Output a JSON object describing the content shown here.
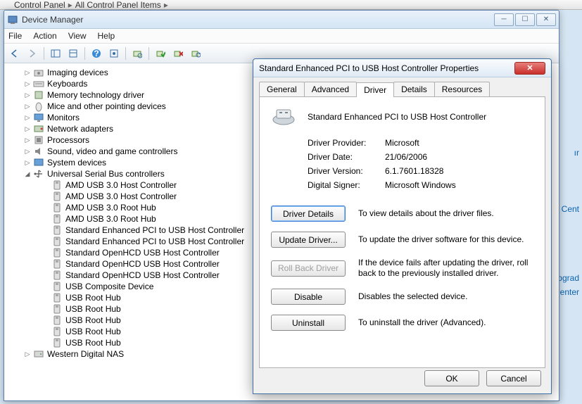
{
  "breadcrumb": {
    "a": "Control Panel",
    "b": "All Control Panel Items"
  },
  "window": {
    "title": "Device Manager",
    "menus": [
      "File",
      "Action",
      "View",
      "Help"
    ]
  },
  "tree": {
    "categories": [
      {
        "label": "Imaging devices",
        "icon": "camera",
        "expand": "▷"
      },
      {
        "label": "Keyboards",
        "icon": "keyboard",
        "expand": "▷"
      },
      {
        "label": "Memory technology driver",
        "icon": "chip",
        "expand": "▷"
      },
      {
        "label": "Mice and other pointing devices",
        "icon": "mouse",
        "expand": "▷"
      },
      {
        "label": "Monitors",
        "icon": "monitor",
        "expand": "▷"
      },
      {
        "label": "Network adapters",
        "icon": "nic",
        "expand": "▷"
      },
      {
        "label": "Processors",
        "icon": "cpu",
        "expand": "▷"
      },
      {
        "label": "Sound, video and game controllers",
        "icon": "sound",
        "expand": "▷"
      },
      {
        "label": "System devices",
        "icon": "system",
        "expand": "▷"
      },
      {
        "label": "Universal Serial Bus controllers",
        "icon": "usb",
        "expand": "◢",
        "expanded": true
      }
    ],
    "usb_children": [
      "AMD USB 3.0 Host Controller",
      "AMD USB 3.0 Host Controller",
      "AMD USB 3.0 Root Hub",
      "AMD USB 3.0 Root Hub",
      "Standard Enhanced PCI to USB Host Controller",
      "Standard Enhanced PCI to USB Host Controller",
      "Standard OpenHCD USB Host Controller",
      "Standard OpenHCD USB Host Controller",
      "Standard OpenHCD USB Host Controller",
      "USB Composite Device",
      "USB Root Hub",
      "USB Root Hub",
      "USB Root Hub",
      "USB Root Hub",
      "USB Root Hub"
    ],
    "tail": {
      "label": "Western Digital NAS",
      "icon": "disk",
      "expand": "▷"
    }
  },
  "dialog": {
    "title": "Standard Enhanced PCI to USB Host Controller Properties",
    "tabs": [
      "General",
      "Advanced",
      "Driver",
      "Details",
      "Resources"
    ],
    "active_tab": "Driver",
    "device_name": "Standard Enhanced PCI to USB Host Controller",
    "fields": {
      "provider_label": "Driver Provider:",
      "provider_value": "Microsoft",
      "date_label": "Driver Date:",
      "date_value": "21/06/2006",
      "version_label": "Driver Version:",
      "version_value": "6.1.7601.18328",
      "signer_label": "Digital Signer:",
      "signer_value": "Microsoft Windows"
    },
    "buttons": {
      "details": "Driver Details",
      "details_desc": "To view details about the driver files.",
      "update": "Update Driver...",
      "update_desc": "To update the driver software for this device.",
      "rollback": "Roll Back Driver",
      "rollback_desc": "If the device fails after updating the driver, roll back to the previously installed driver.",
      "disable": "Disable",
      "disable_desc": "Disables the selected device.",
      "uninstall": "Uninstall",
      "uninstall_desc": "To uninstall the driver (Advanced).",
      "ok": "OK",
      "cancel": "Cancel"
    }
  },
  "bg_fragments": {
    "a": "ır",
    "b": "ng Cent",
    "c": "pgrad",
    "d": "enter"
  }
}
